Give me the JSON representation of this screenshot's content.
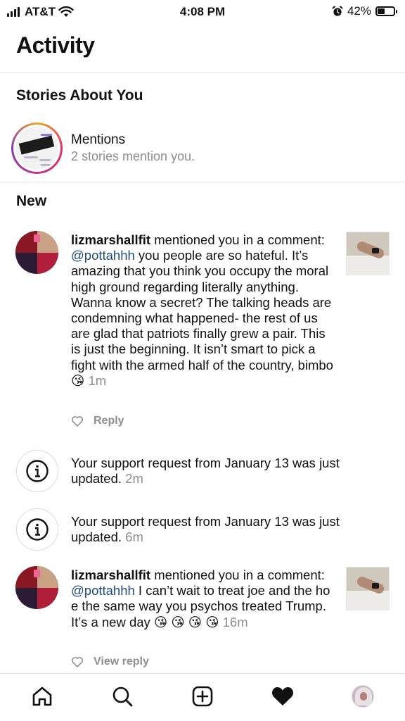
{
  "status_bar": {
    "carrier": "AT&T",
    "time": "4:08 PM",
    "battery_percent": "42%",
    "battery_level": 0.42,
    "icons": [
      "signal-bars-icon",
      "wifi-icon",
      "alarm-icon",
      "battery-icon"
    ]
  },
  "header": {
    "title": "Activity"
  },
  "stories": {
    "heading": "Stories About You",
    "title": "Mentions",
    "subtitle": "2 stories mention you."
  },
  "new_section": {
    "heading": "New"
  },
  "notifications": [
    {
      "type": "comment",
      "username": "lizmarshallfit",
      "action": " mentioned you in a comment: ",
      "mention": "@pottahhh",
      "text": " you people are so hateful. It’s amazing that you think you occupy the moral high ground regarding literally anything. Wanna know a secret? The talking heads are condemning what happened- the rest of us are glad that patriots finally grew a pair. This is just the beginning. It isn’t smart to pick a fight with the armed half of the country, bimbo 😘",
      "time": "1m",
      "reply_label": "Reply"
    },
    {
      "type": "info",
      "text": "Your support request from January 13 was just updated.",
      "time": "2m"
    },
    {
      "type": "info",
      "text": "Your support request from January 13 was just updated.",
      "time": "6m"
    },
    {
      "type": "comment",
      "username": "lizmarshallfit",
      "action": " mentioned you in a comment: ",
      "mention": "@pottahhh",
      "text": " I can’t wait to treat joe and the ho e the same way you psychos treated Trump. It’s a new day 😘 😘 😘 😘",
      "time": "16m",
      "reply_label": "View reply"
    }
  ],
  "tab_bar": {
    "tabs": [
      "home-icon",
      "search-icon",
      "create-post-icon",
      "activity-heart-icon",
      "profile-avatar"
    ]
  }
}
